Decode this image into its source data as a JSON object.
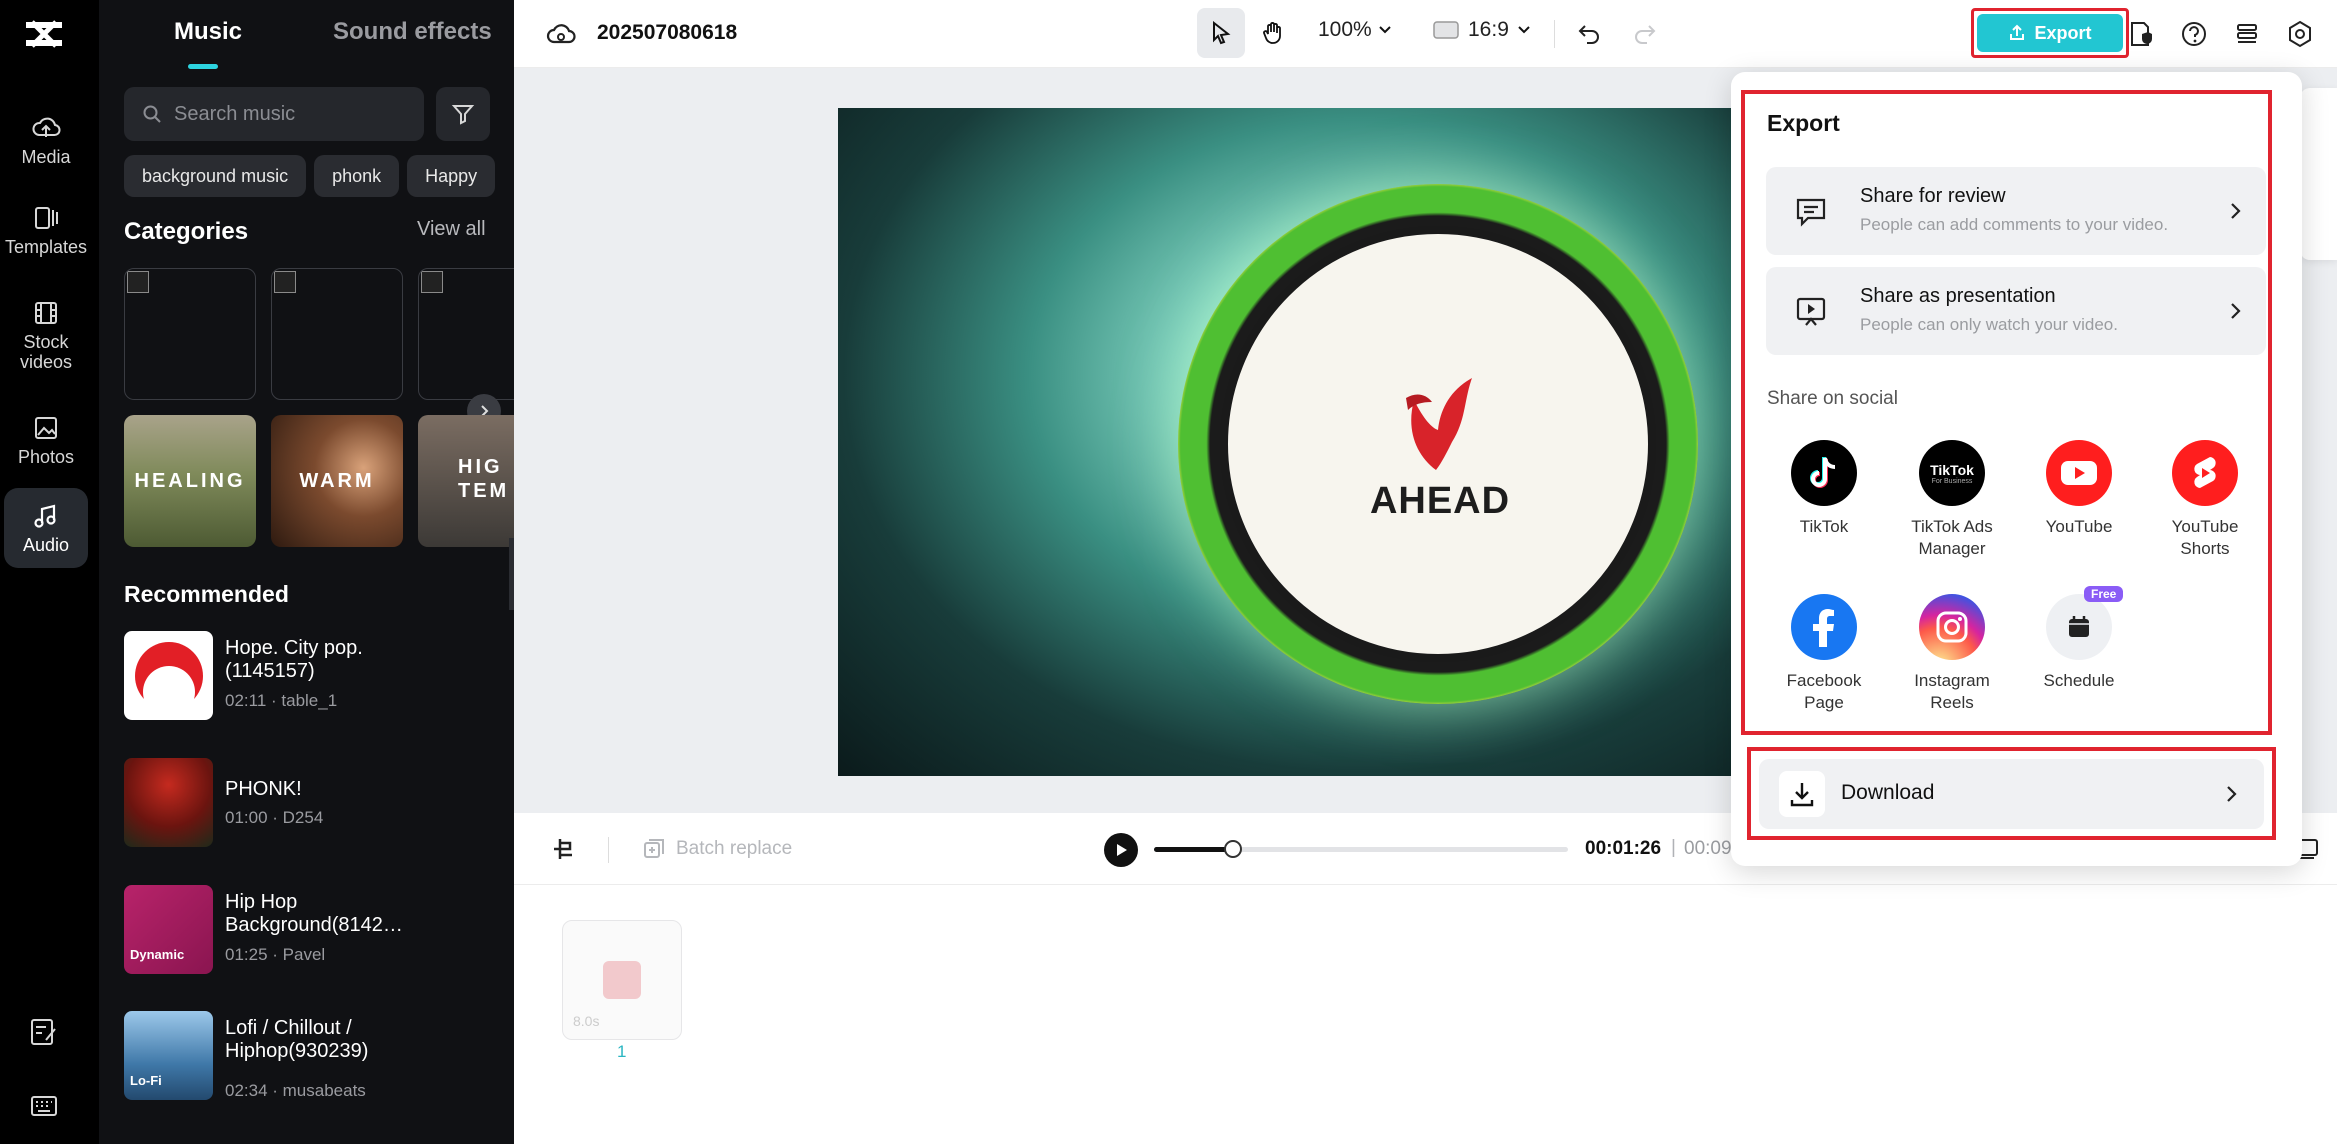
{
  "rail": {
    "items": [
      {
        "label": "Media",
        "icon": "cloud-upload-icon"
      },
      {
        "label": "Templates",
        "icon": "templates-icon"
      },
      {
        "label": "Stock\nvideos",
        "icon": "film-icon"
      },
      {
        "label": "Photos",
        "icon": "image-icon"
      },
      {
        "label": "Audio",
        "icon": "music-note-icon"
      }
    ]
  },
  "panel": {
    "tab_music": "Music",
    "tab_sfx": "Sound effects",
    "search_placeholder": "Search music",
    "chips": [
      "background music",
      "phonk",
      "Happy"
    ],
    "categories_title": "Categories",
    "view_all": "View all",
    "category_thumbs": [
      "HEALING",
      "WARM",
      "HIG\nTEM"
    ],
    "recommended_title": "Recommended",
    "tracks": [
      {
        "title": "Hope. City pop.(1145157)",
        "meta": "02:11 · table_1",
        "thumb_label": ""
      },
      {
        "title": "PHONK!",
        "meta": "01:00 · D254",
        "thumb_label": ""
      },
      {
        "title": "Hip Hop Background(8142…",
        "meta": "01:25 · Pavel",
        "thumb_label": "Dynamic"
      },
      {
        "title": "Lofi / Chillout / Hiphop(930239)",
        "meta": "02:34 · musabeats",
        "thumb_label": "Lo-Fi"
      }
    ]
  },
  "topbar": {
    "project_name": "202507080618",
    "zoom": "100%",
    "ratio": "16:9",
    "export_label": "Export"
  },
  "video": {
    "logo_text": "AHEAD"
  },
  "player": {
    "batch_replace": "Batch replace",
    "current_time": "00:01:26",
    "separator": "|",
    "total_time": "00:09",
    "progress": 0.19
  },
  "timeline": {
    "clip_duration": "8.0s",
    "clip_number": "1"
  },
  "export_menu": {
    "title": "Export",
    "share_review_title": "Share for review",
    "share_review_sub": "People can add comments to your video.",
    "share_presentation_title": "Share as presentation",
    "share_presentation_sub": "People can only watch your video.",
    "social_label": "Share on social",
    "social": [
      {
        "label": "TikTok",
        "color": "#000000"
      },
      {
        "label": "TikTok Ads\nManager",
        "color": "#000000"
      },
      {
        "label": "YouTube",
        "color": "#ff1e1e"
      },
      {
        "label": "YouTube\nShorts",
        "color": "#ff1e1e"
      },
      {
        "label": "Facebook\nPage",
        "color": "#1877f2"
      },
      {
        "label": "Instagram\nReels",
        "color": "#d6249f"
      },
      {
        "label": "Schedule",
        "color": "#eef0f3"
      }
    ],
    "free_badge": "Free",
    "tiktok_ads_mark": "TikTok",
    "tiktok_ads_sub": "For Business",
    "download_label": "Download"
  },
  "colors": {
    "accent": "#22c6d2",
    "highlight": "#e0242f"
  }
}
